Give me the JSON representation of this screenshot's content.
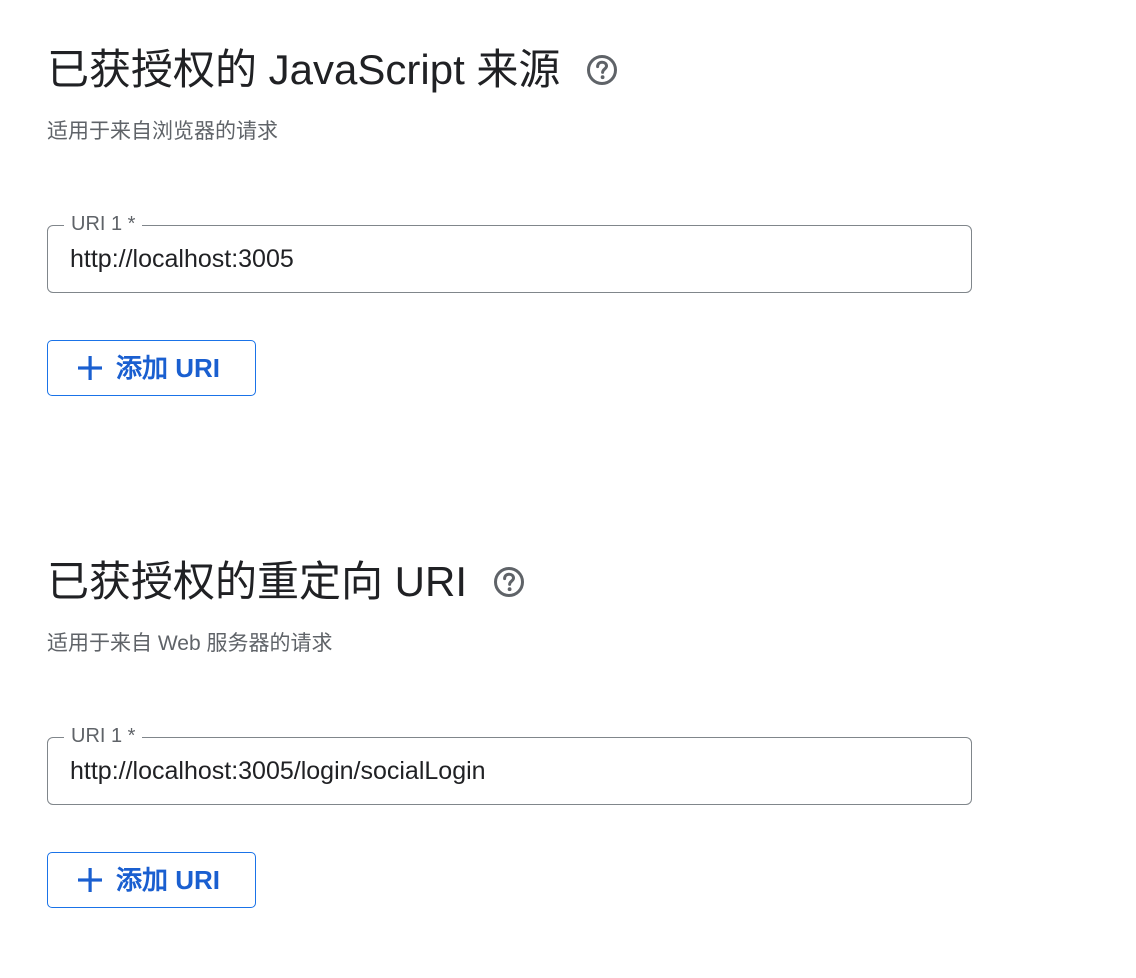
{
  "js_origins": {
    "title": "已获授权的 JavaScript 来源",
    "subtitle": "适用于来自浏览器的请求",
    "field_label": "URI 1 *",
    "field_value": "http://localhost:3005",
    "add_button_label": "添加 URI",
    "help_icon": "help-circle-icon",
    "add_icon": "plus-icon"
  },
  "redirect_uris": {
    "title": "已获授权的重定向 URI",
    "subtitle": "适用于来自 Web 服务器的请求",
    "field_label": "URI 1 *",
    "field_value": "http://localhost:3005/login/socialLogin",
    "add_button_label": "添加 URI",
    "help_icon": "help-circle-icon",
    "add_icon": "plus-icon"
  },
  "colors": {
    "title_text": "#202124",
    "secondary_text": "#5f6368",
    "field_border": "#80868b",
    "accent_blue": "#1a73e8",
    "button_text": "#1a5fd0"
  }
}
